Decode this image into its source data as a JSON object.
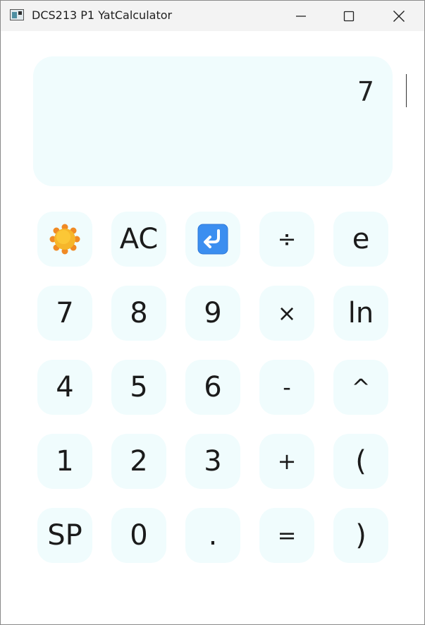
{
  "window": {
    "title": "DCS213 P1 YatCalculator"
  },
  "display": {
    "value": "7"
  },
  "keys": {
    "theme": "",
    "ac": "AC",
    "back": "",
    "div": "÷",
    "e": "e",
    "d7": "7",
    "d8": "8",
    "d9": "9",
    "mul": "×",
    "ln": "ln",
    "d4": "4",
    "d5": "5",
    "d6": "6",
    "sub": "-",
    "pow": "^",
    "d1": "1",
    "d2": "2",
    "d3": "3",
    "add": "+",
    "lparen": "(",
    "sp": "SP",
    "d0": "0",
    "dot": ".",
    "eq": "=",
    "rparen": ")"
  },
  "icons": {
    "theme": "sun-icon",
    "back": "return-arrow-icon",
    "minimize": "minimize-icon",
    "maximize": "maximize-icon",
    "close": "close-icon"
  },
  "colors": {
    "key_bg": "#f0fcfd",
    "display_bg": "#f0fcfd",
    "titlebar_bg": "#f3f3f3",
    "sun": "#f7b52a",
    "return_button": "#3b8ef0"
  }
}
